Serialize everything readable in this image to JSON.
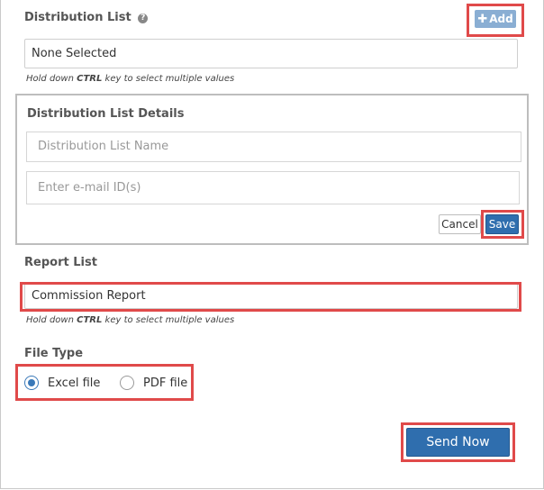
{
  "distribution_list": {
    "title": "Distribution List",
    "help_icon": "question-circle-icon",
    "add_label": "Add",
    "add_icon": "plus-icon",
    "selected_value": "None Selected",
    "hint_prefix": "Hold down ",
    "hint_key": "CTRL",
    "hint_suffix": " key to select multiple values"
  },
  "details": {
    "title": "Distribution List Details",
    "name_placeholder": "Distribution List Name",
    "email_placeholder": "Enter e-mail ID(s)",
    "cancel_label": "Cancel",
    "save_label": "Save"
  },
  "report_list": {
    "title": "Report List",
    "selected_value": "Commission Report",
    "hint_prefix": "Hold down ",
    "hint_key": "CTRL",
    "hint_suffix": " key to select multiple values"
  },
  "file_type": {
    "title": "File Type",
    "options": [
      {
        "label": "Excel file",
        "checked": true
      },
      {
        "label": "PDF file",
        "checked": false
      }
    ]
  },
  "send_now_label": "Send Now",
  "colors": {
    "highlight": "#e04a4a",
    "primary": "#2f6eae",
    "add_button": "#8aaed3"
  }
}
